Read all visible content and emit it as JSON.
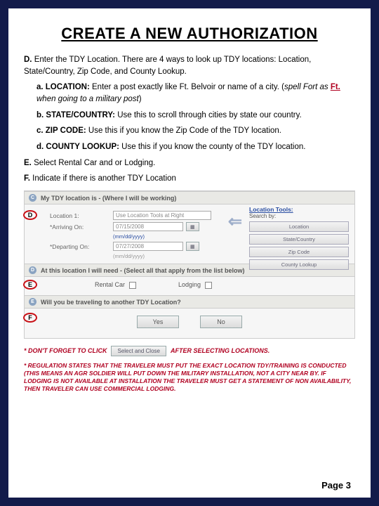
{
  "title": "CREATE A NEW AUTHORIZATION",
  "instructions": {
    "D_lead": "D.",
    "D_text": " Enter the TDY Location.  There are 4 ways to look up TDY locations: Location, State/Country, Zip Code, and County Lookup.",
    "a_lead": "a. LOCATION:",
    "a_text": " Enter a post exactly like Ft. Belvoir or  name of a city.  (",
    "a_italic1": "spell Fort as ",
    "a_ft": "Ft.",
    "a_italic2": " when going to a military post",
    "a_close": ")",
    "b_lead": "b. STATE/COUNTRY:",
    "b_text": " Use this to scroll through cities by state our country.",
    "c_lead": "c. ZIP CODE:",
    "c_text": " Use this if you know the Zip Code of the TDY location.",
    "d_lead": "d. COUNTY LOOKUP:",
    "d_text": " Use this if you know the county of the TDY location.",
    "E_lead": "E.",
    "E_text": " Select Rental Car and or Lodging.",
    "F_lead": "F.",
    "F_text": " Indicate if there is another TDY Location"
  },
  "app": {
    "secC_letter": "C",
    "secC_title": "My TDY location is - (Where I will be working)",
    "loc_label": "Location 1:",
    "loc_field": "Use Location Tools at Right",
    "arr_label": "*Arriving On:",
    "arr_field": "07/15/2008",
    "dep_label": "*Departing On:",
    "dep_field": "07/27/2008",
    "fmt_hint": "(mm/dd/yyyy)",
    "tools_title": "Location Tools:",
    "tools_sub": "Search by:",
    "btn1": "Location",
    "btn2": "State/Country",
    "btn3": "Zip Code",
    "btn4": "County Lookup",
    "secD_letter": "D",
    "secD_title": "At this location I will need - (Select all that apply from the list below)",
    "rental": "Rental Car",
    "lodging": "Lodging",
    "secE_letter": "E",
    "secE_title": "Will you be traveling to another TDY Location?",
    "yes": "Yes",
    "no": "No",
    "cal_icon": "▦"
  },
  "circles": {
    "D": "D",
    "E": "E",
    "F": "F"
  },
  "footer": {
    "dont_forget": "* DON'T FORGET TO CLICK",
    "select_btn": "Select and Close",
    "after": "AFTER SELECTING LOCATIONS.",
    "regulation": "* REGULATION STATES THAT THE TRAVELER MUST PUT THE EXACT LOCATION TDY/TRAINING IS CONDUCTED (THIS MEANS AN AGR SOLDIER WILL PUT DOWN THE MILITARY INSTALLATION, NOT A CITY NEAR BY. IF LODGING IS NOT AVAILABLE AT INSTALLATION THE TRAVELER MUST GET A STATEMENT OF NON AVAILABILITY, THEN TRAVELER CAN USE COMMERCIAL LODGING.",
    "page": "Page 3"
  }
}
